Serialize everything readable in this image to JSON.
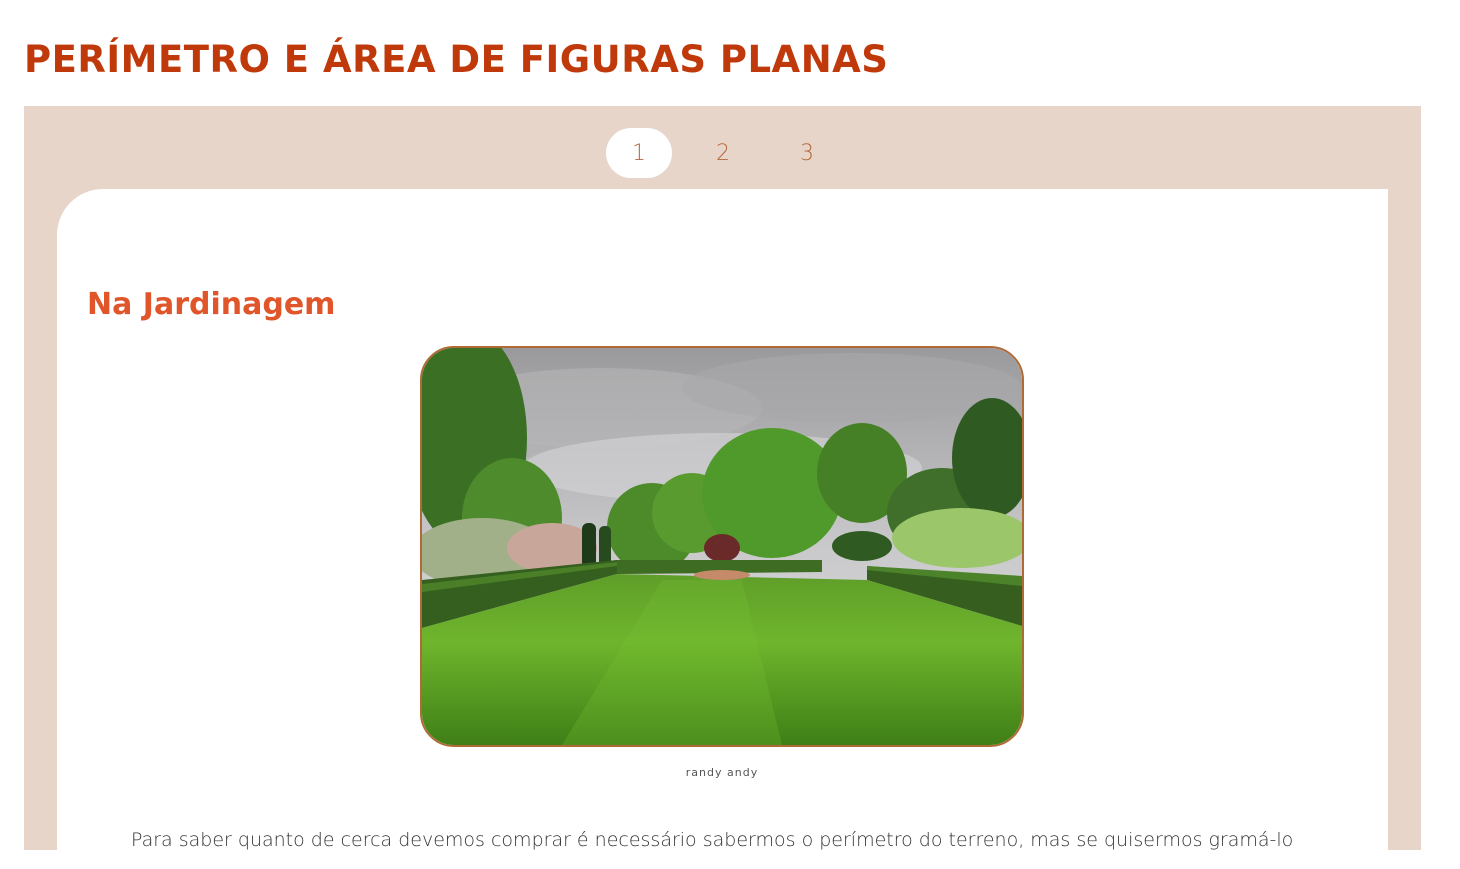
{
  "page": {
    "title": "PERÍMETRO E ÁREA DE FIGURAS PLANAS"
  },
  "pagination": {
    "pages": [
      "1",
      "2",
      "3"
    ],
    "active_index": 0
  },
  "section": {
    "title": "Na Jardinagem",
    "image": {
      "icon": "garden-lawn-photo",
      "caption": "randy andy"
    },
    "body": "Para saber quanto de cerca devemos comprar é necessário sabermos o perímetro do terreno, mas se quisermos gramá-lo"
  },
  "colors": {
    "title": "#c0390b",
    "section_title": "#e0552a",
    "panel_bg": "#e7d5c9",
    "pager_text": "#b5673a",
    "photo_border": "#b06a36"
  }
}
